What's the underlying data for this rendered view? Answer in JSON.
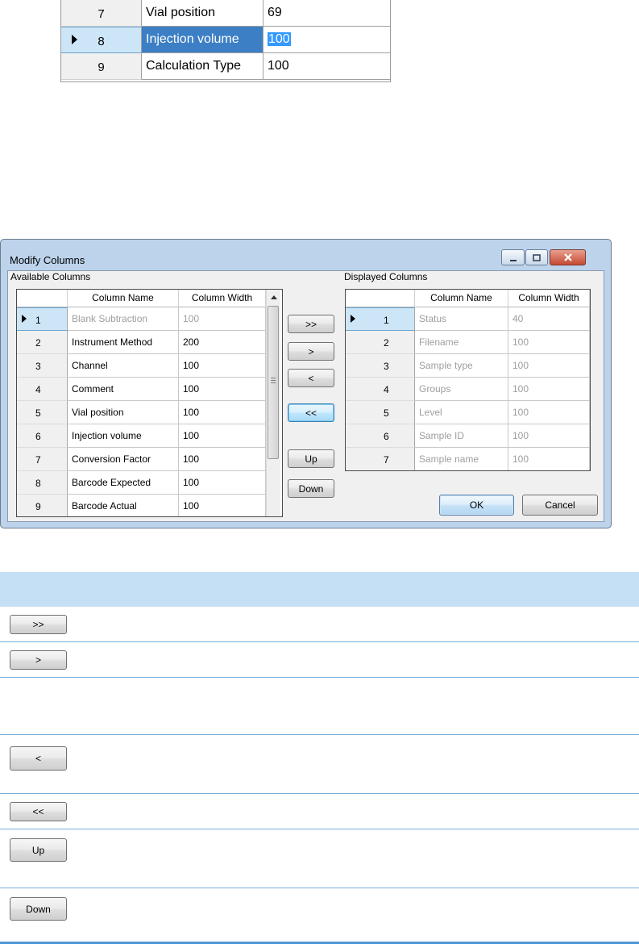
{
  "top_grid": {
    "rows": [
      {
        "num": "7",
        "name": "Vial position",
        "value": "69"
      },
      {
        "num": "8",
        "name": "Injection volume",
        "value": "100"
      },
      {
        "num": "9",
        "name": "Calculation Type",
        "value": "100"
      }
    ],
    "selected_row": "8"
  },
  "dialog": {
    "title": "Modify Columns",
    "available": {
      "group_label": "Available Columns",
      "headers": {
        "name": "Column Name",
        "width": "Column Width"
      },
      "rows": [
        {
          "num": "1",
          "name": "Blank Subtraction",
          "width": "100"
        },
        {
          "num": "2",
          "name": "Instrument Method",
          "width": "200"
        },
        {
          "num": "3",
          "name": "Channel",
          "width": "100"
        },
        {
          "num": "4",
          "name": "Comment",
          "width": "100"
        },
        {
          "num": "5",
          "name": "Vial position",
          "width": "100"
        },
        {
          "num": "6",
          "name": "Injection volume",
          "width": "100"
        },
        {
          "num": "7",
          "name": "Conversion Factor",
          "width": "100"
        },
        {
          "num": "8",
          "name": "Barcode Expected",
          "width": "100"
        },
        {
          "num": "9",
          "name": "Barcode Actual",
          "width": "100"
        }
      ]
    },
    "displayed": {
      "group_label": "Displayed Columns",
      "headers": {
        "name": "Column Name",
        "width": "Column Width"
      },
      "rows": [
        {
          "num": "1",
          "name": "Status",
          "width": "40"
        },
        {
          "num": "2",
          "name": "Filename",
          "width": "100"
        },
        {
          "num": "3",
          "name": "Sample type",
          "width": "100"
        },
        {
          "num": "4",
          "name": "Groups",
          "width": "100"
        },
        {
          "num": "5",
          "name": "Level",
          "width": "100"
        },
        {
          "num": "6",
          "name": "Sample ID",
          "width": "100"
        },
        {
          "num": "7",
          "name": "Sample name",
          "width": "100"
        }
      ]
    },
    "buttons": {
      "add_all": ">>",
      "add": ">",
      "remove": "<",
      "remove_all": "<<",
      "up": "Up",
      "down": "Down",
      "ok": "OK",
      "cancel": "Cancel"
    },
    "window_controls": {
      "minimize": "▭",
      "maximize": "▫",
      "close": "✕"
    }
  },
  "doc_table": {
    "buttons": [
      ">>",
      ">",
      "<",
      "<<",
      "Up",
      "Down"
    ]
  },
  "colors": {
    "dialog_frame": "#bcd3eb",
    "selection_blue": "#3d7fc4",
    "doc_header": "#c5dff5",
    "doc_rule": "#7aaedb"
  }
}
